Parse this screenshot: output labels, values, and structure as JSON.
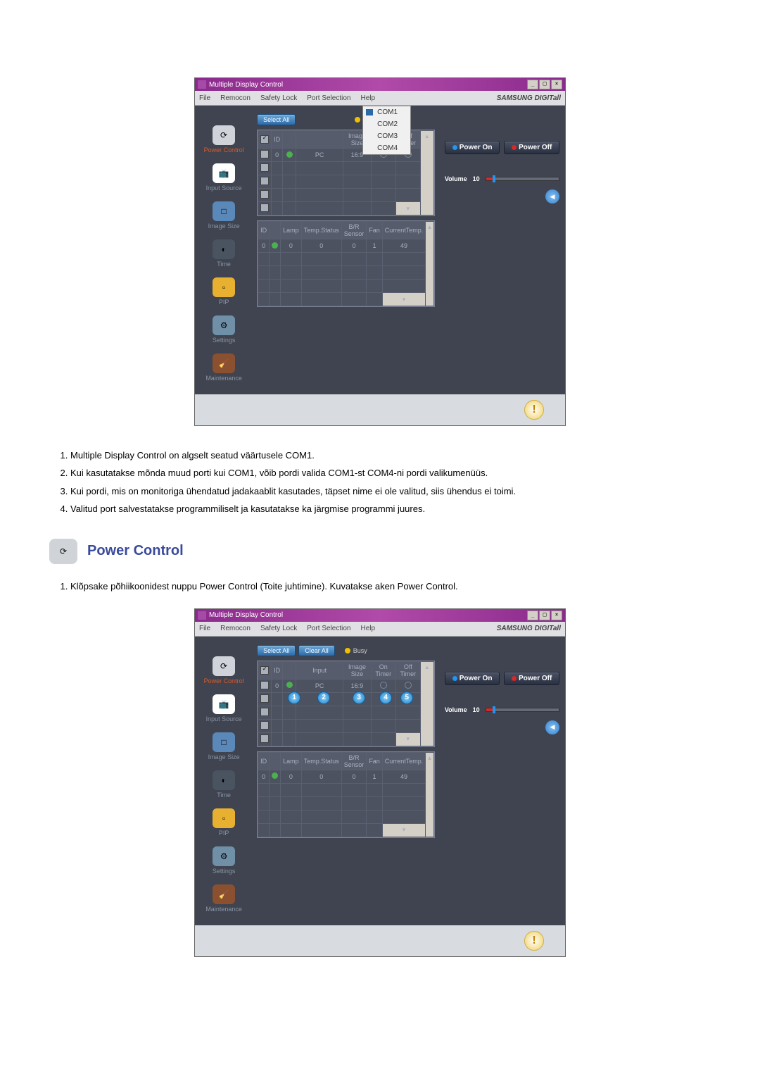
{
  "app": {
    "title": "Multiple Display Control",
    "menus": [
      "File",
      "Remocon",
      "Safety Lock",
      "Port Selection",
      "Help"
    ],
    "brand": "SAMSUNG DIGITall"
  },
  "sidebar": {
    "items": [
      {
        "label": "Power Control",
        "active": true
      },
      {
        "label": "Input Source"
      },
      {
        "label": "Image Size"
      },
      {
        "label": "Time"
      },
      {
        "label": "PIP"
      },
      {
        "label": "Settings"
      },
      {
        "label": "Maintenance"
      }
    ]
  },
  "toolbar": {
    "select_all": "Select All",
    "clear_all": "Clear All",
    "busy": "Busy"
  },
  "com_menu": [
    "COM1",
    "COM2",
    "COM3",
    "COM4"
  ],
  "grid1": {
    "headers": [
      "",
      "ID",
      "",
      "Input",
      "Image Size",
      "On Timer",
      "Off Timer"
    ],
    "row": {
      "id": "0",
      "input": "PC",
      "imagesize": "16:9"
    }
  },
  "grid2": {
    "headers": [
      "ID",
      "",
      "Lamp",
      "Temp.Status",
      "B/R Sensor",
      "Fan",
      "CurrentTemp."
    ],
    "row": {
      "id": "0",
      "lamp": "0",
      "temp": "0",
      "br": "0",
      "fan": "1",
      "curr": "49"
    }
  },
  "power": {
    "on": "Power On",
    "off": "Power Off",
    "volume_label": "Volume",
    "volume_value": "10"
  },
  "doc_list1": [
    "Multiple Display Control on algselt seatud väärtusele COM1.",
    "Kui kasutatakse mõnda muud porti kui COM1, võib pordi valida COM1-st COM4-ni pordi valikumenüüs.",
    "Kui pordi, mis on monitoriga ühendatud jadakaablit kasutades, täpset nime ei ole valitud, siis ühendus ei toimi.",
    "Valitud port salvestatakse programmiliselt ja kasutatakse ka järgmise programmi juures."
  ],
  "section": {
    "title": "Power Control"
  },
  "doc_list2": [
    "Klõpsake põhiikoonidest nuppu Power Control (Toite juhtimine). Kuvatakse aken Power Control."
  ],
  "callouts": [
    "1",
    "2",
    "3",
    "4",
    "5"
  ]
}
